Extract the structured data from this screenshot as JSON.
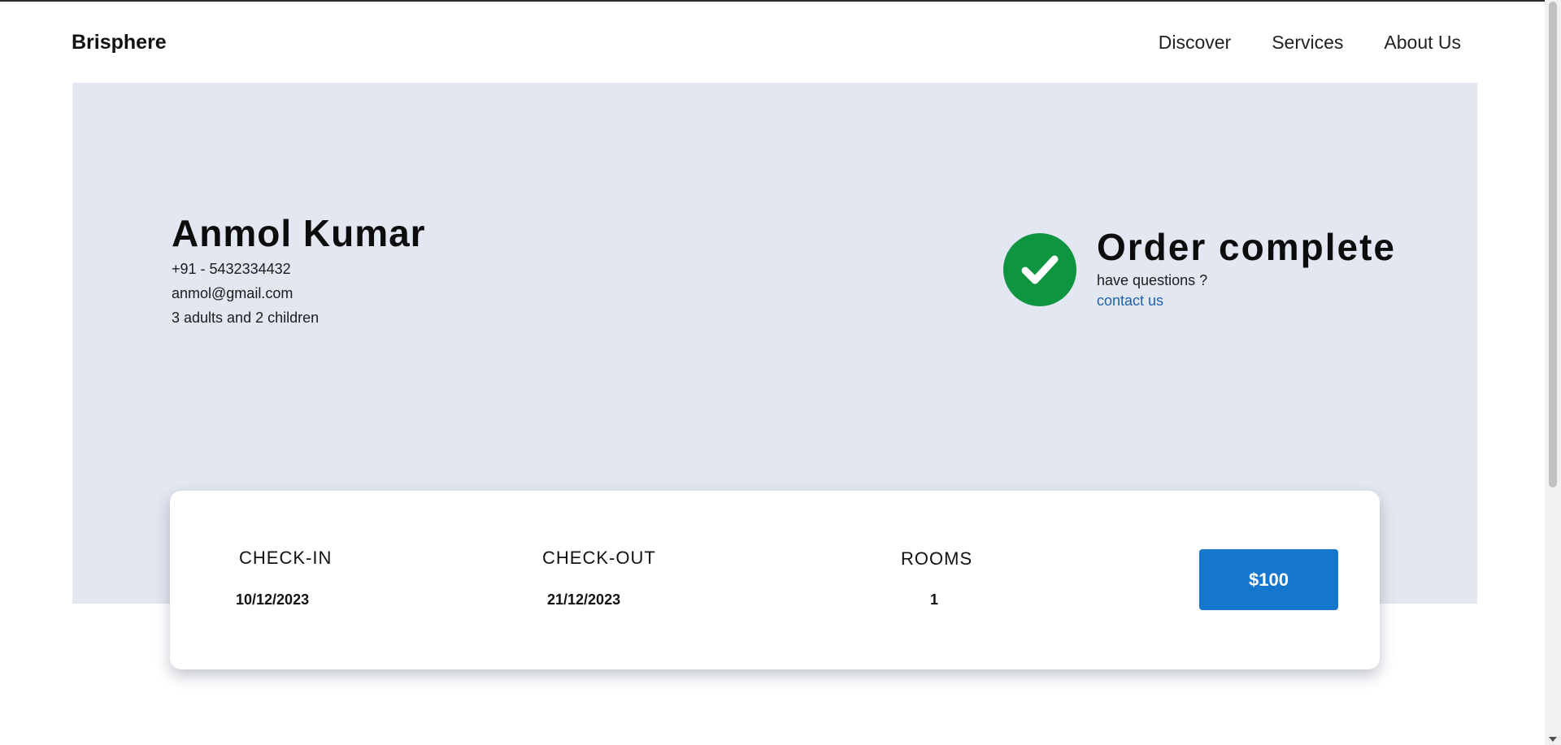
{
  "header": {
    "brand": "Brisphere",
    "nav": [
      "Discover",
      "Services",
      "About Us"
    ]
  },
  "guest": {
    "name": "Anmol Kumar",
    "phone": "+91 - 5432334432",
    "email": "anmol@gmail.com",
    "party": "3 adults and 2 children"
  },
  "status": {
    "title": "Order complete",
    "subtitle": "have questions ?",
    "link": "contact us",
    "icon": "check-circle-icon",
    "color": "#0f9440"
  },
  "booking": {
    "checkin_label": "CHECK-IN",
    "checkin_value": "10/12/2023",
    "checkout_label": "CHECK-OUT",
    "checkout_value": "21/12/2023",
    "rooms_label": "ROOMS",
    "rooms_value": "1",
    "price": "$100"
  },
  "colors": {
    "hero_background": "#e2e7f1",
    "accent": "#1576ce",
    "link": "#1e63b0"
  }
}
